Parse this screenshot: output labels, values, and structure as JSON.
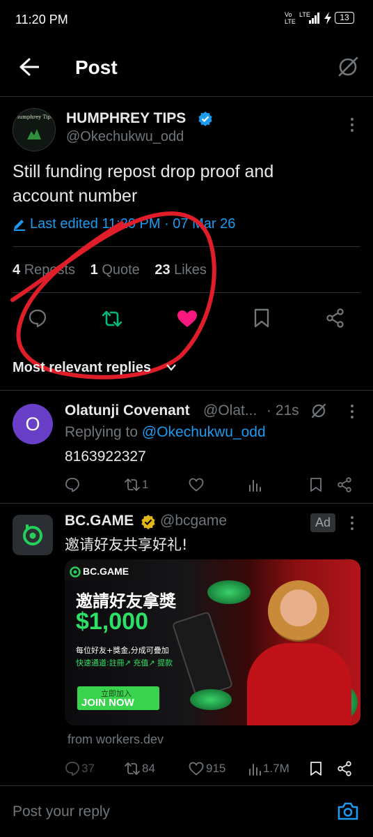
{
  "status_bar": {
    "time": "11:20 PM",
    "network1": "Vo LTE",
    "network2": "LTE",
    "battery": "13"
  },
  "header": {
    "title": "Post"
  },
  "post": {
    "author_name": "HUMPHREY TIPS",
    "handle": "@Okechukwu_odd",
    "avatar_text": "Humphrey Tips",
    "text_line1": "Still funding repost drop proof and",
    "text_line2": "account number",
    "edited": "Last edited 11:20 PM · 07 Mar 26",
    "stats": {
      "reposts_count": "4",
      "reposts_label": "Reposts",
      "quotes_count": "1",
      "quotes_label": "Quote",
      "likes_count": "23",
      "likes_label": "Likes"
    }
  },
  "replies_filter": "Most relevant replies",
  "reply": {
    "avatar_letter": "O",
    "name": "Olatunji Covenant",
    "handle": "@Olat...",
    "time": "· 21s",
    "replying_prefix": "Replying to",
    "replying_to": "@Okechukwu_odd",
    "text": "8163922327",
    "retweet_count": "1"
  },
  "ad": {
    "name": "BC.GAME",
    "handle": "@bcgame",
    "badge": "Ad",
    "text": "邀请好友共享好礼!",
    "image": {
      "logo_text": "BC.GAME",
      "headline": "邀請好友拿獎",
      "amount": "$1,000",
      "line1": "每位好友+獎金,分成可疊加",
      "line2": "快速通道:註冊↗ 充值↗ 提款",
      "cta_top": "立即加入",
      "cta": "JOIN NOW"
    },
    "source": "from workers.dev",
    "stats": {
      "replies": "37",
      "reposts": "84",
      "likes": "915",
      "views": "1.7M"
    }
  },
  "composer": {
    "placeholder": "Post your reply"
  },
  "colors": {
    "accent_blue": "#1d9bf0",
    "repost_green": "#00ba7c",
    "like_pink": "#f91880",
    "annotation_red": "#e01e2a",
    "reply_avatar_purple": "#6a3fc8"
  }
}
